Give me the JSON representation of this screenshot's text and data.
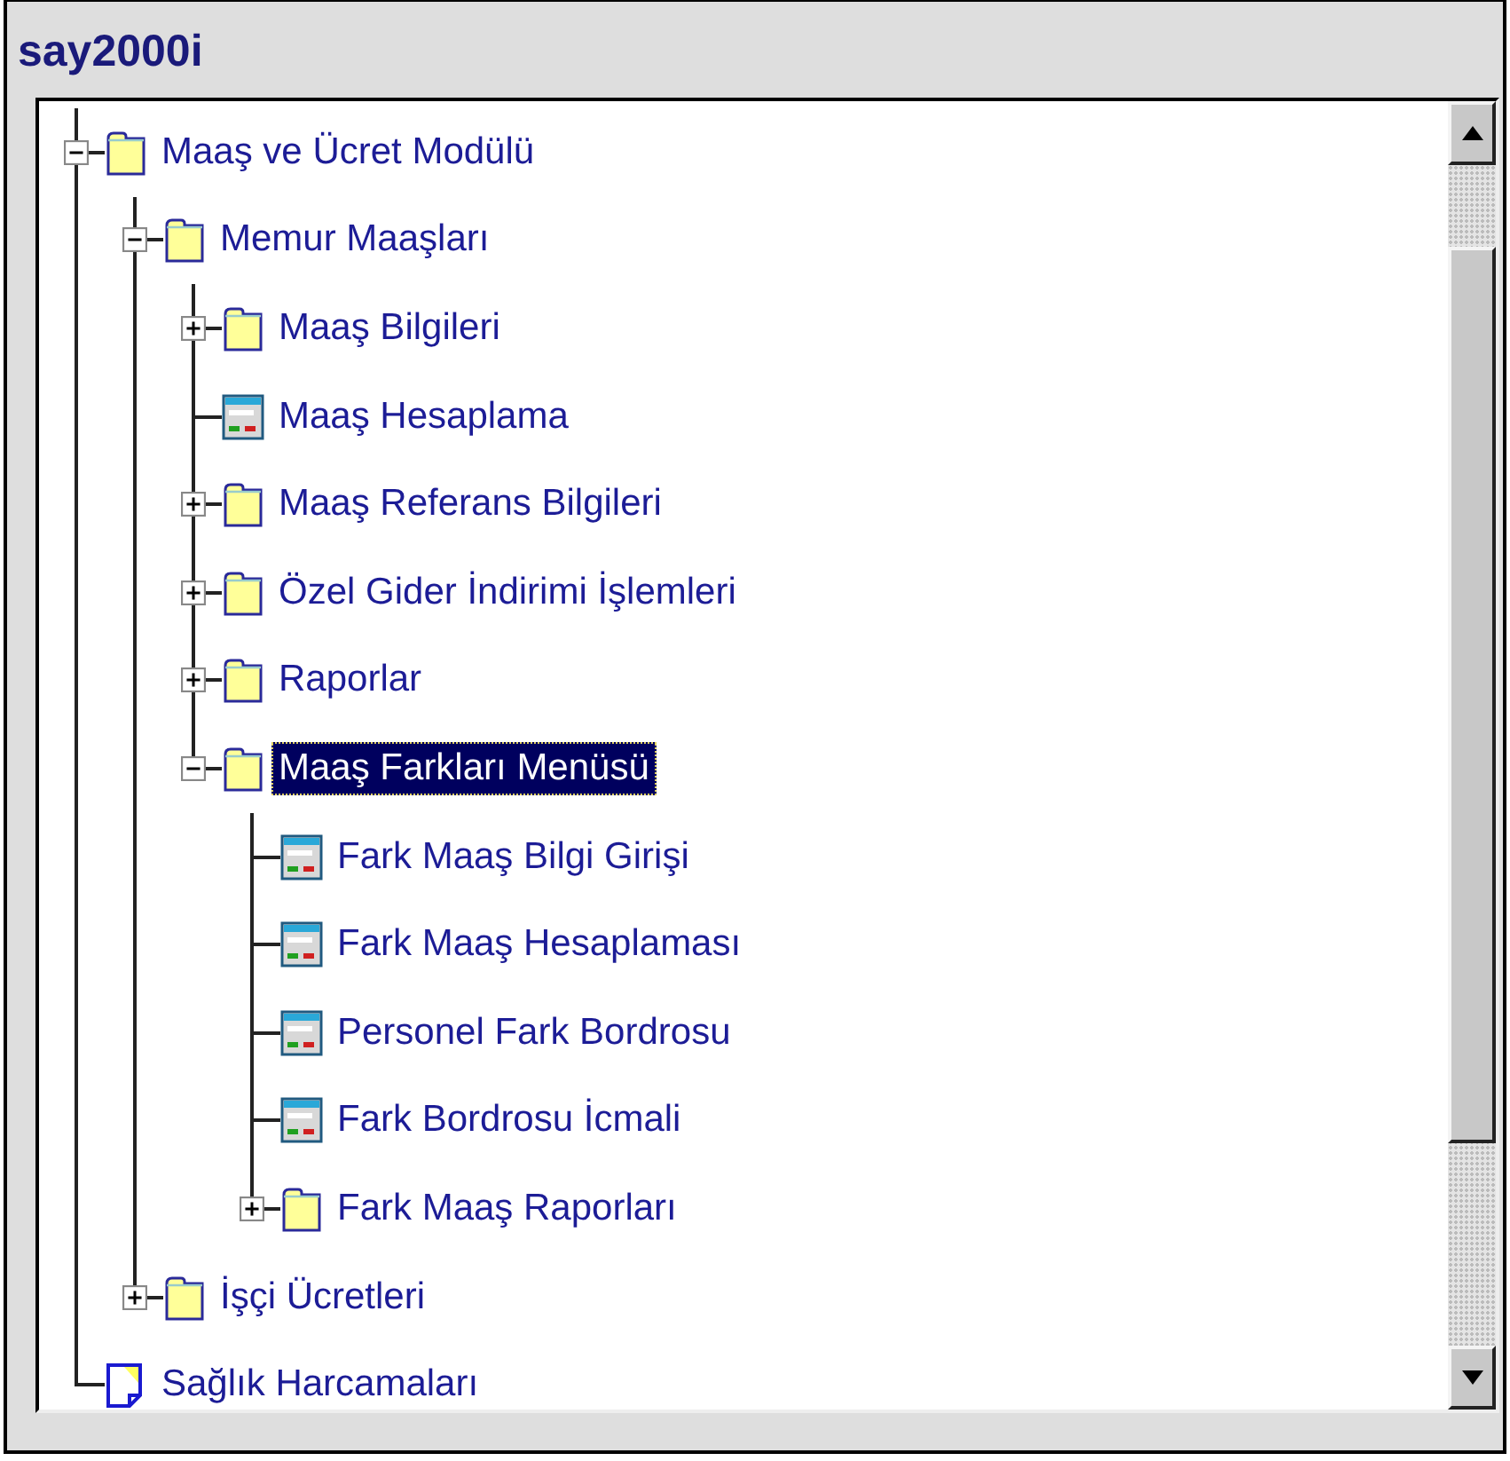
{
  "window": {
    "title": "say2000i"
  },
  "tree": [
    {
      "label": "Maaş ve Ücret Modülü",
      "kind": "folder",
      "expanded": true,
      "selected": false,
      "children": [
        {
          "label": "Memur Maaşları",
          "kind": "folder",
          "expanded": true,
          "selected": false,
          "children": [
            {
              "label": "Maaş Bilgileri",
              "kind": "folder",
              "expanded": false,
              "selected": false
            },
            {
              "label": "Maaş Hesaplama",
              "kind": "form",
              "selected": false
            },
            {
              "label": "Maaş Referans Bilgileri",
              "kind": "folder",
              "expanded": false,
              "selected": false
            },
            {
              "label": "Özel Gider İndirimi İşlemleri",
              "kind": "folder",
              "expanded": false,
              "selected": false
            },
            {
              "label": "Raporlar",
              "kind": "folder",
              "expanded": false,
              "selected": false
            },
            {
              "label": "Maaş Farkları Menüsü",
              "kind": "folder",
              "expanded": true,
              "selected": true,
              "children": [
                {
                  "label": "Fark Maaş Bilgi Girişi",
                  "kind": "form",
                  "selected": false
                },
                {
                  "label": "Fark Maaş Hesaplaması",
                  "kind": "form",
                  "selected": false
                },
                {
                  "label": "Personel Fark Bordrosu",
                  "kind": "form",
                  "selected": false
                },
                {
                  "label": "Fark Bordrosu İcmali",
                  "kind": "form",
                  "selected": false
                },
                {
                  "label": "Fark Maaş Raporları",
                  "kind": "folder",
                  "expanded": false,
                  "selected": false
                }
              ]
            }
          ]
        },
        {
          "label": "İşçi Ücretleri",
          "kind": "folder",
          "expanded": false,
          "selected": false
        }
      ]
    },
    {
      "label": "Sağlık Harcamaları",
      "kind": "document",
      "selected": false
    }
  ]
}
